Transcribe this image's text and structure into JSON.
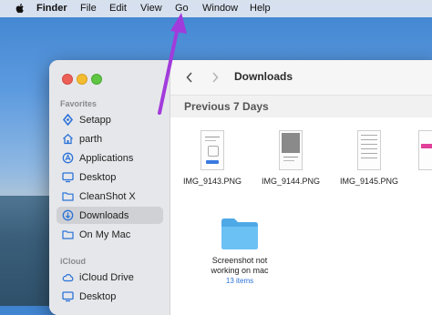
{
  "menubar": {
    "apple_icon": "apple-icon",
    "app_name": "Finder",
    "items": [
      "File",
      "Edit",
      "View",
      "Go",
      "Window",
      "Help"
    ]
  },
  "window": {
    "toolbar": {
      "back_icon": "chevron-left-icon",
      "forward_icon": "chevron-right-icon",
      "title": "Downloads"
    },
    "sidebar": {
      "favorites_title": "Favorites",
      "favorites": [
        {
          "label": "Setapp",
          "icon": "setapp-icon"
        },
        {
          "label": "parth",
          "icon": "home-icon"
        },
        {
          "label": "Applications",
          "icon": "applications-icon"
        },
        {
          "label": "Desktop",
          "icon": "desktop-icon"
        },
        {
          "label": "CleanShot X",
          "icon": "folder-icon"
        },
        {
          "label": "Downloads",
          "icon": "download-icon",
          "selected": true
        },
        {
          "label": "On My Mac",
          "icon": "folder-icon"
        }
      ],
      "icloud_title": "iCloud",
      "icloud": [
        {
          "label": "iCloud Drive",
          "icon": "cloud-icon"
        },
        {
          "label": "Desktop",
          "icon": "desktop-icon"
        }
      ]
    },
    "content": {
      "group_title": "Previous 7 Days",
      "files": [
        {
          "name": "IMG_9143.PNG",
          "icon": "image-thumbnail-icon"
        },
        {
          "name": "IMG_9144.PNG",
          "icon": "image-thumbnail-icon"
        },
        {
          "name": "IMG_9145.PNG",
          "icon": "image-thumbnail-icon"
        }
      ],
      "folder": {
        "name_line1": "Screenshot not",
        "name_line2": "working on mac",
        "count": "13 items",
        "icon": "folder-icon"
      }
    }
  },
  "annotation": {
    "arrow_color": "#a23bdc",
    "icon": "arrow-up-icon"
  },
  "colors": {
    "accent": "#2a72d8",
    "folder_blue": "#5bb8f0"
  }
}
